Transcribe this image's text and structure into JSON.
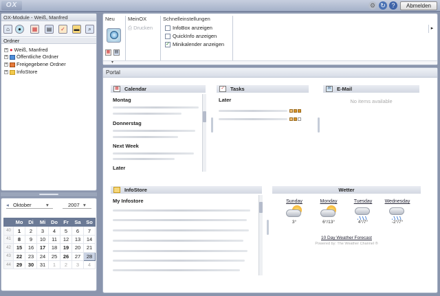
{
  "app": {
    "logo": "OX",
    "logout_label": "Abmelden"
  },
  "left": {
    "title": "OX-Module - Weiß, Manfred",
    "folders_label": "Ordner",
    "tree": [
      {
        "label": "Weiß, Manfred",
        "icon": "user-icon"
      },
      {
        "label": "Öffentliche Ordner",
        "icon": "public-folders-icon"
      },
      {
        "label": "Freigegebene Ordner",
        "icon": "shared-folders-icon"
      },
      {
        "label": "InfoStore",
        "icon": "folder-icon"
      }
    ]
  },
  "calendar": {
    "month": "Oktober",
    "year": "2007",
    "weekdays": [
      "Mo",
      "Di",
      "Mi",
      "Do",
      "Fr",
      "Sa",
      "So"
    ],
    "weeks": [
      {
        "wk": "40",
        "days": [
          "1",
          "2",
          "3",
          "4",
          "5",
          "6",
          "7"
        ]
      },
      {
        "wk": "41",
        "days": [
          "8",
          "9",
          "10",
          "11",
          "12",
          "13",
          "14"
        ]
      },
      {
        "wk": "42",
        "days": [
          "15",
          "16",
          "17",
          "18",
          "19",
          "20",
          "21"
        ]
      },
      {
        "wk": "43",
        "days": [
          "22",
          "23",
          "24",
          "25",
          "26",
          "27",
          "28"
        ]
      },
      {
        "wk": "44",
        "days": [
          "29",
          "30",
          "31",
          "1",
          "2",
          "3",
          "4"
        ]
      }
    ],
    "today": "28"
  },
  "ribbon": {
    "sections": {
      "new": "Neu",
      "myox": "MeinOX",
      "quick": "Schnelleinstellungen"
    },
    "print_label": "Drucken",
    "options": [
      {
        "label": "InfoBox anzeigen",
        "checked": false
      },
      {
        "label": "QuickInfo anzeigen",
        "checked": false
      },
      {
        "label": "Minikalender anzeigen",
        "checked": true
      }
    ]
  },
  "portal": {
    "title": "Portal",
    "calendar": {
      "title": "Calendar",
      "sections": [
        "Montag",
        "Donnerstag",
        "Next Week",
        "Later"
      ]
    },
    "tasks": {
      "title": "Tasks",
      "sections": [
        "Later"
      ]
    },
    "email": {
      "title": "E-Mail",
      "empty": "No items available"
    },
    "infostore": {
      "title": "InfoStore",
      "sections": [
        "My Infostore"
      ]
    },
    "weather": {
      "title": "Wetter",
      "days": [
        {
          "day": "Sunday",
          "temp": "3°",
          "icon": "partly-sunny-icon"
        },
        {
          "day": "Monday",
          "temp": "6°/13°",
          "icon": "partly-sunny-icon"
        },
        {
          "day": "Tuesday",
          "temp": "4°/7°",
          "icon": "rain-icon"
        },
        {
          "day": "Wednesday",
          "temp": "-2°/7°",
          "icon": "rain-icon"
        }
      ],
      "forecast_link": "10 Day Weather Forecast",
      "powered_by": "Powered by: The Weather Channel ®"
    }
  }
}
